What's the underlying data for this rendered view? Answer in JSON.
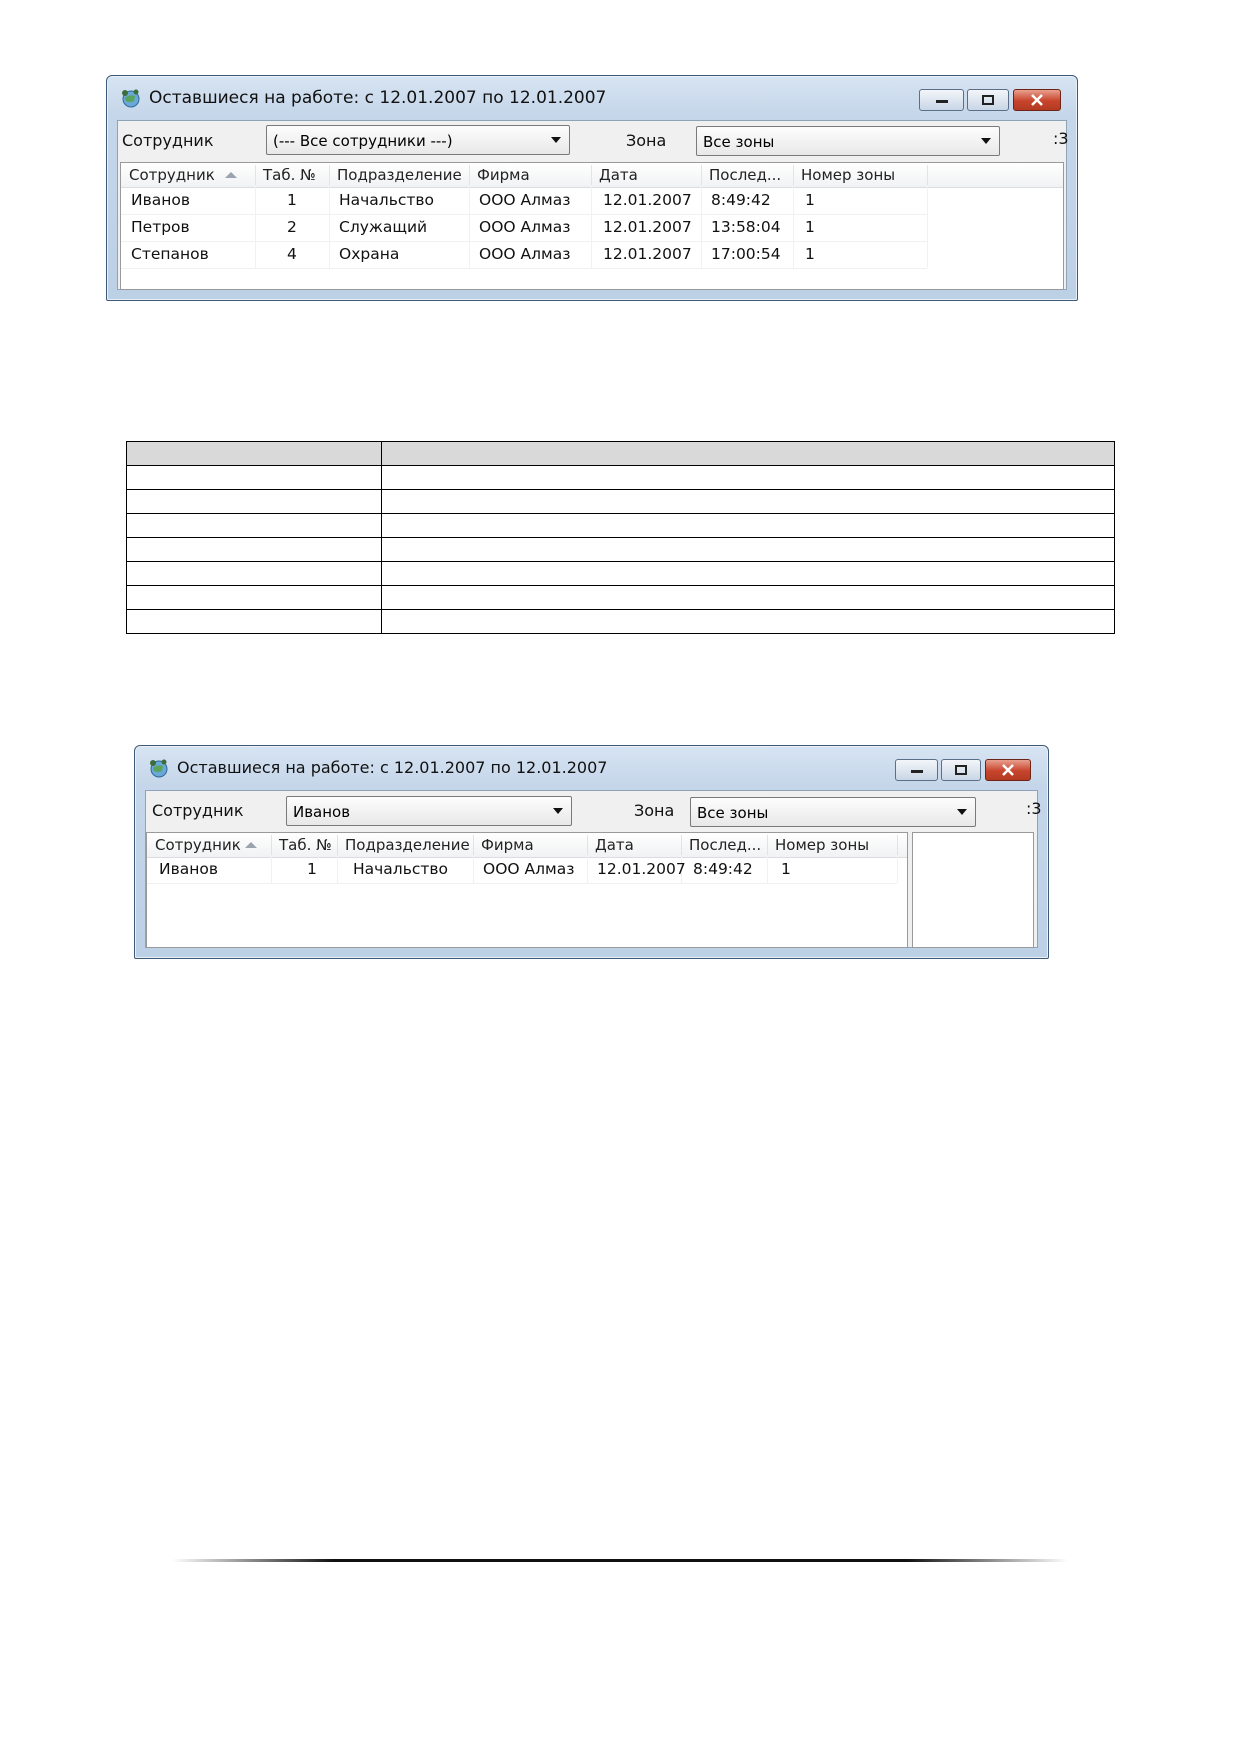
{
  "window1": {
    "title": "Оставшиеся на работе: с 12.01.2007 по 12.01.2007",
    "employee_label": "Сотрудник",
    "employee_value": "(--- Все сотрудники ---)",
    "zone_label": "Зона",
    "zone_value": "Все зоны",
    "edge_text": ":3",
    "columns": [
      "Сотрудник",
      "Таб. №",
      "Подразделение",
      "Фирма",
      "Дата",
      "Послед...",
      "Номер зоны"
    ],
    "rows": [
      [
        "Иванов",
        "1",
        "Начальство",
        "ООО Алмаз",
        "12.01.2007",
        "8:49:42",
        "1"
      ],
      [
        "Петров",
        "2",
        "Служащий",
        "ООО Алмаз",
        "12.01.2007",
        "13:58:04",
        "1"
      ],
      [
        "Степанов",
        "4",
        "Охрана",
        "ООО Алмаз",
        "12.01.2007",
        "17:00:54",
        "1"
      ]
    ]
  },
  "window2": {
    "title": "Оставшиеся на работе: с 12.01.2007 по 12.01.2007",
    "employee_label": "Сотрудник",
    "employee_value": "Иванов",
    "zone_label": "Зона",
    "zone_value": "Все зоны",
    "edge_text": ":3",
    "columns": [
      "Сотрудник",
      "Таб. №",
      "Подразделение",
      "Фирма",
      "Дата",
      "Послед...",
      "Номер зоны"
    ],
    "rows": [
      [
        "Иванов",
        "1",
        "Начальство",
        "ООО Алмаз",
        "12.01.2007",
        "8:49:42",
        "1"
      ]
    ]
  },
  "icons": {
    "app": "globe-people-icon",
    "minimize": "minimize-icon",
    "maximize": "maximize-icon",
    "close": "close-icon",
    "sort": "sort-ascending-icon",
    "dropdown": "chevron-down-icon"
  },
  "colors": {
    "title_bar": "#c5d6ea",
    "close_button": "#c7442c",
    "table_header": "#d9d9d9"
  }
}
